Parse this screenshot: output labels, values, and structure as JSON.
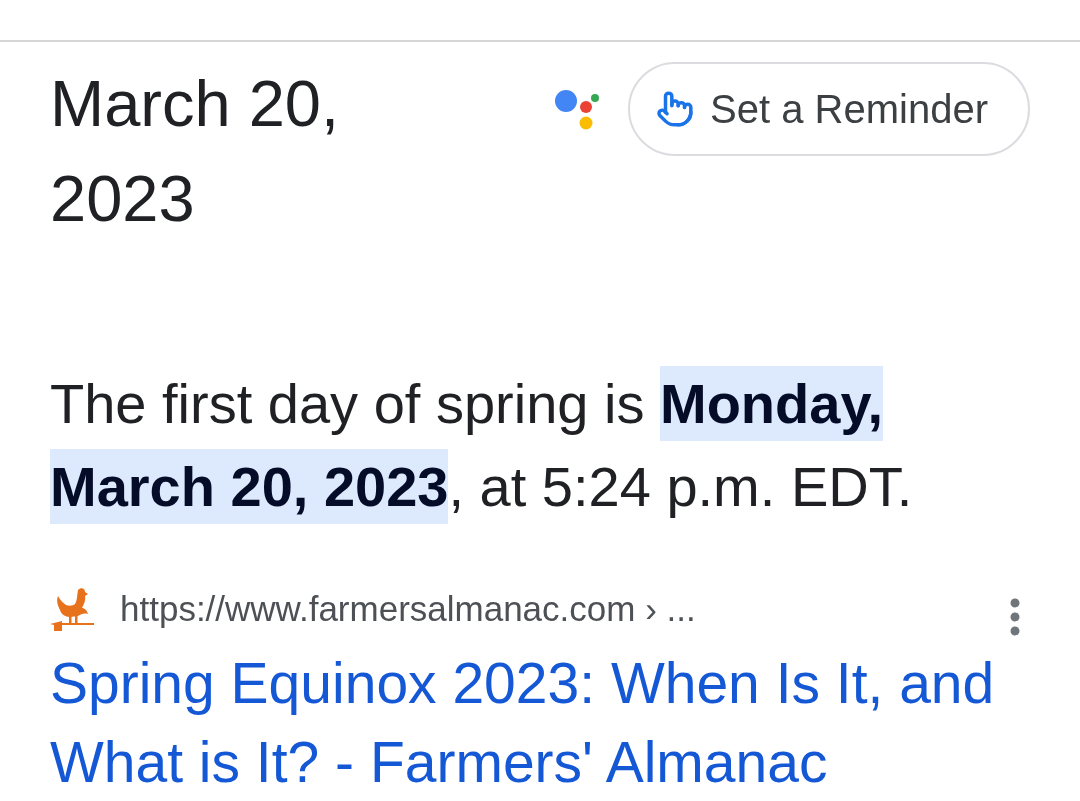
{
  "answer_card": {
    "date": "March 20, 2023",
    "reminder_button": {
      "label": "Set a Reminder"
    }
  },
  "snippet": "The first day of spring is **Monday, March 20, 2023**, at 5:24 p.m. EDT.",
  "result": {
    "url": "https://www.farmersalmanac.com › ...",
    "title": "Spring Equinox 2023: When Is It, and What is It? - Farmers' Almanac"
  }
}
